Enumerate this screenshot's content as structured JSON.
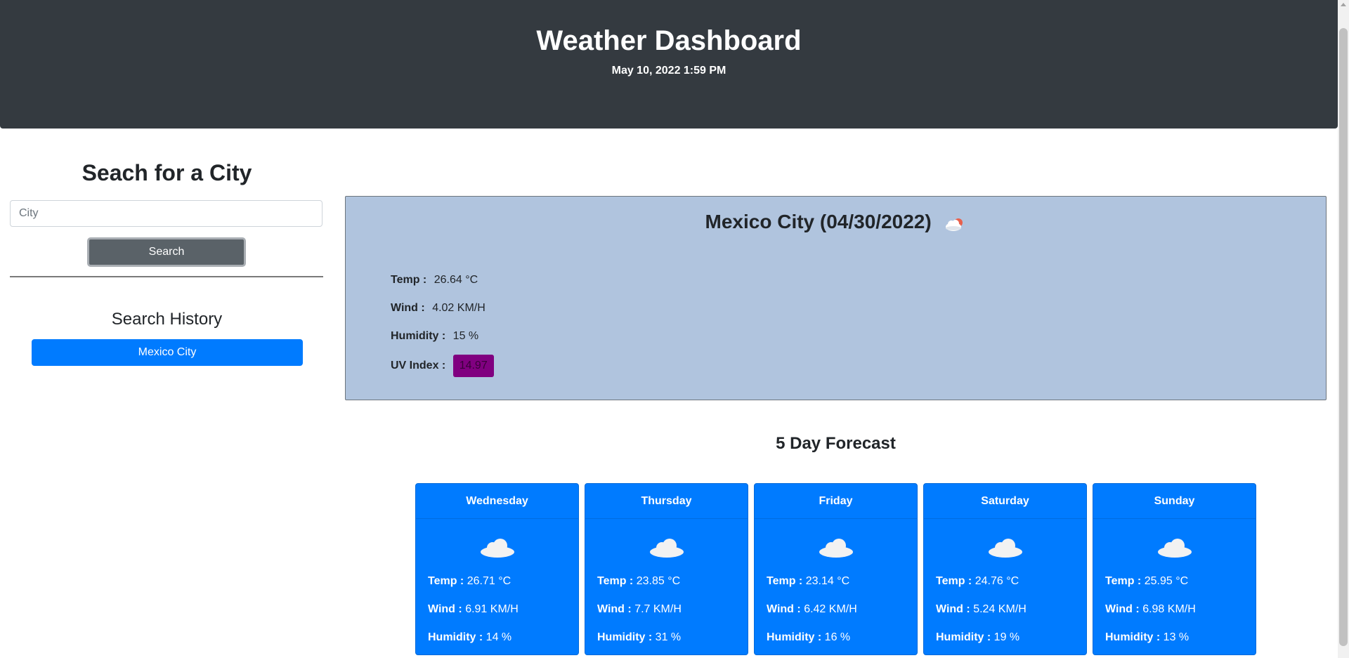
{
  "header": {
    "title": "Weather Dashboard",
    "datetime": "May 10, 2022 1:59 PM"
  },
  "sidebar": {
    "title": "Seach for a City",
    "search_placeholder": "City",
    "search_value": "",
    "search_button": "Search",
    "history_title": "Search History",
    "history": [
      "Mexico City"
    ]
  },
  "current": {
    "title": "Mexico City (04/30/2022)",
    "icon": "partly-cloudy-icon",
    "temp_label": "Temp :",
    "temp": "26.64 °C",
    "wind_label": "Wind :",
    "wind": "4.02 KM/H",
    "humidity_label": "Humidity :",
    "humidity": "15 %",
    "uv_label": "UV Index :",
    "uv": "14.97",
    "uv_color": "#800080"
  },
  "forecast": {
    "title": "5 Day Forecast",
    "temp_label": "Temp :",
    "wind_label": "Wind :",
    "humidity_label": "Humidity :",
    "days": [
      {
        "day": "Wednesday",
        "icon": "cloud-icon",
        "temp": "26.71 °C",
        "wind": "6.91 KM/H",
        "humidity": "14 %"
      },
      {
        "day": "Thursday",
        "icon": "cloud-icon",
        "temp": "23.85 °C",
        "wind": "7.7 KM/H",
        "humidity": "31 %"
      },
      {
        "day": "Friday",
        "icon": "cloud-icon",
        "temp": "23.14 °C",
        "wind": "6.42 KM/H",
        "humidity": "16 %"
      },
      {
        "day": "Saturday",
        "icon": "cloud-icon",
        "temp": "24.76 °C",
        "wind": "5.24 KM/H",
        "humidity": "19 %"
      },
      {
        "day": "Sunday",
        "icon": "cloud-icon",
        "temp": "25.95 °C",
        "wind": "6.98 KM/H",
        "humidity": "13 %"
      }
    ]
  },
  "colors": {
    "header_bg": "#343a40",
    "panel_bg": "#b0c4de",
    "card_bg": "#007bff",
    "button_secondary": "#5a6268"
  }
}
